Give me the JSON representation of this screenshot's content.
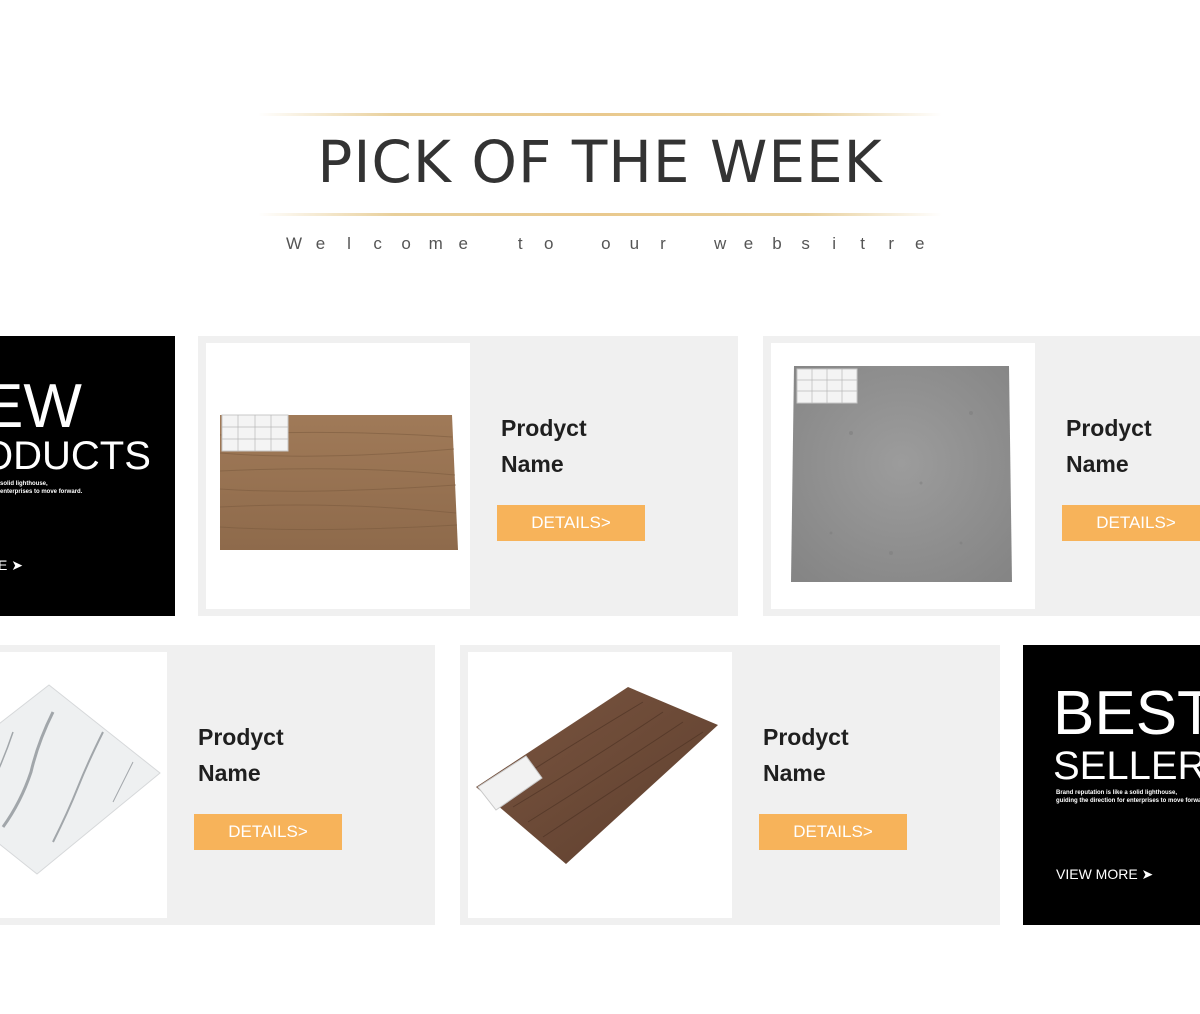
{
  "header": {
    "title": "PICK OF THE WEEK",
    "subtitle_chars": [
      "W",
      "e",
      "l",
      "c",
      "o",
      "m",
      "e",
      " ",
      "t",
      "o",
      " ",
      "o",
      "u",
      "r",
      " ",
      "w",
      "e",
      "b",
      "s",
      "i",
      "t",
      "r",
      "e"
    ]
  },
  "colors": {
    "accent": "#f7b35a",
    "gold_line": "#e9c98e",
    "card_bg": "#f0f0f0",
    "promo_bg": "#000000"
  },
  "promo_new": {
    "line1": "EW",
    "line2": "ODUCTS",
    "desc_line1": "solid lighthouse,",
    "desc_line2": "enterprises to move forward.",
    "more_label": "E ➤"
  },
  "promo_best": {
    "line1": "BEST",
    "line2": "SELLER",
    "desc_line1": "Brand reputation is like a solid lighthouse,",
    "desc_line2": "guiding the direction for enterprises to move forward.",
    "more_label": "VIEW MORE ➤"
  },
  "products": [
    {
      "name_line1": "Prodyct",
      "name_line2": "Name",
      "button_label": "DETAILS>",
      "image": "light-wood-plank-sample"
    },
    {
      "name_line1": "Prodyct",
      "name_line2": "Name",
      "button_label": "DETAILS>",
      "image": "grey-stone-tile-sample"
    },
    {
      "name_line1": "Prodyct",
      "name_line2": "Name",
      "button_label": "DETAILS>",
      "image": "white-marble-tile-sample"
    },
    {
      "name_line1": "Prodyct",
      "name_line2": "Name",
      "button_label": "DETAILS>",
      "image": "dark-wood-plank-sample"
    }
  ]
}
